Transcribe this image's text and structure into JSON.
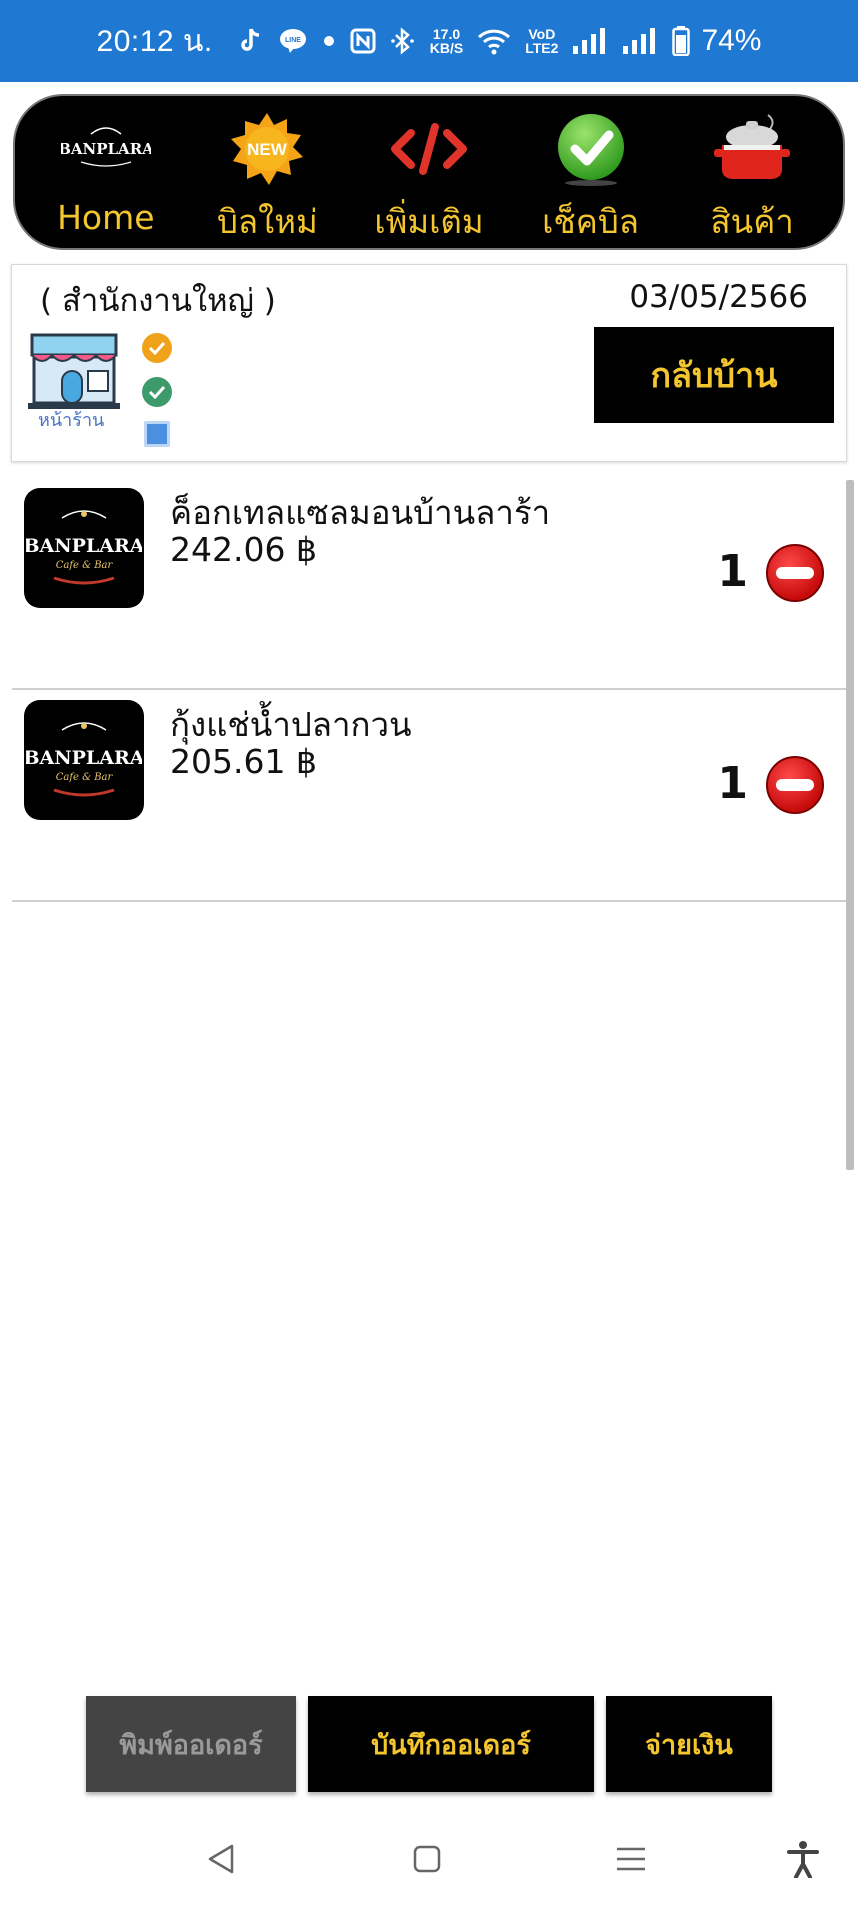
{
  "status_bar": {
    "time": "20:12 น.",
    "net_speed_value": "17.0",
    "net_speed_unit": "KB/S",
    "volte_top": "VoD",
    "volte_bottom": "LTE2",
    "battery": "74%"
  },
  "nav": {
    "items": [
      {
        "label": "Home",
        "icon": "banplara-logo-icon"
      },
      {
        "label": "บิลใหม่",
        "icon": "new-badge-icon",
        "badge_text": "NEW"
      },
      {
        "label": "เพิ่มเติม",
        "icon": "code-icon"
      },
      {
        "label": "เช็คบิล",
        "icon": "checkmark-icon"
      },
      {
        "label": "สินค้า",
        "icon": "cooking-pot-icon"
      }
    ],
    "logo_text": "BANPLARA"
  },
  "info": {
    "branch": "( สำนักงานใหญ่ )",
    "date": "03/05/2566",
    "shop_label": "หน้าร้าน",
    "home_button": "กลับบ้าน"
  },
  "orders": [
    {
      "name": "ค็อกเทลแซลมอนบ้านลาร้า",
      "price": "242.06 ฿",
      "qty": "1",
      "logo_text": "BANPLARA",
      "logo_sub": "Cafe & Bar"
    },
    {
      "name": "กุ้งแช่น้ำปลากวน",
      "price": "205.61 ฿",
      "qty": "1",
      "logo_text": "BANPLARA",
      "logo_sub": "Cafe & Bar"
    }
  ],
  "actions": {
    "print": "พิมพ์ออเดอร์",
    "save": "บันทึกออเดอร์",
    "pay": "จ่ายเงิน"
  },
  "colors": {
    "status_bar": "#1f78d1",
    "accent_yellow": "#f3c52e",
    "nav_bg": "#000000",
    "remove_red": "#d41414"
  }
}
